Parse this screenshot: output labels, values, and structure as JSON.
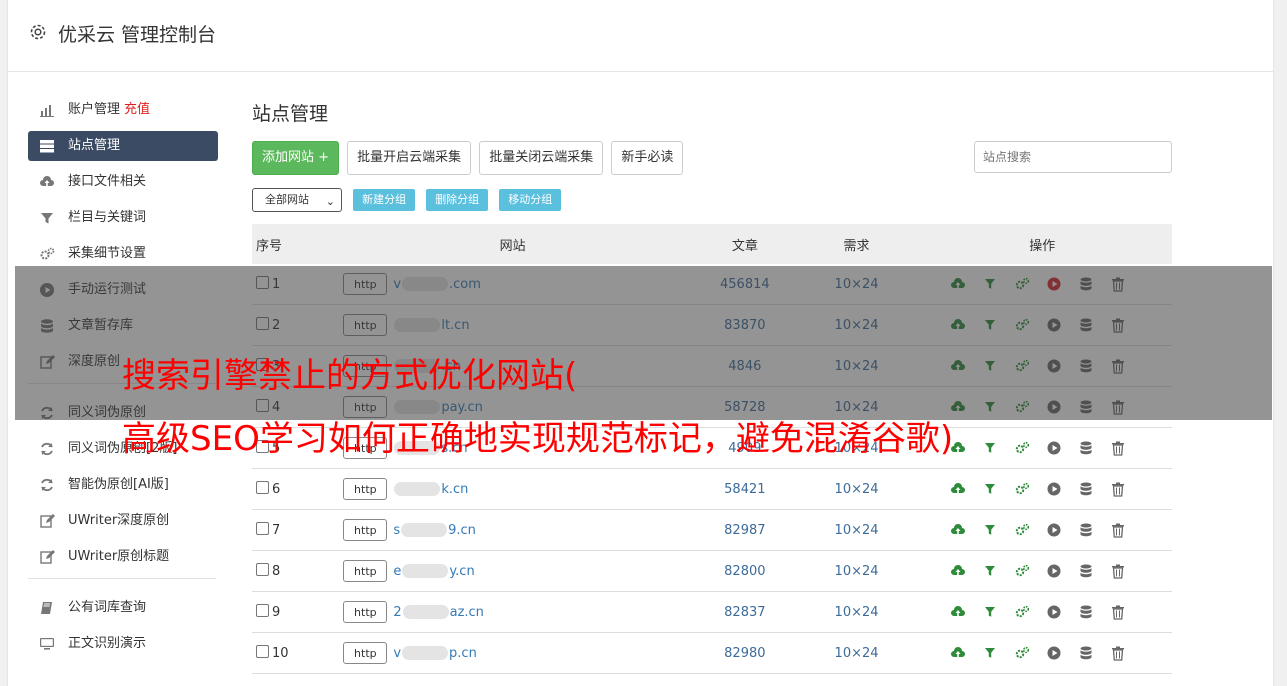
{
  "header": {
    "title": "优采云 管理控制台"
  },
  "sidebar": {
    "items": [
      {
        "label": "账户管理",
        "extra": "充值",
        "icon": "bar-chart-icon"
      },
      {
        "label": "站点管理",
        "icon": "server-icon",
        "active": true
      },
      {
        "label": "接口文件相关",
        "icon": "cloud-upload-icon"
      },
      {
        "label": "栏目与关键词",
        "icon": "filter-icon"
      },
      {
        "label": "采集细节设置",
        "icon": "gears-icon"
      },
      {
        "label": "手动运行测试",
        "icon": "play-circle-icon"
      },
      {
        "label": "文章暂存库",
        "icon": "database-icon"
      },
      {
        "label": "深度原创",
        "icon": "edit-icon"
      }
    ],
    "items2": [
      {
        "label": "同义词伪原创",
        "icon": "refresh-icon"
      },
      {
        "label": "同义词伪原创[2版]",
        "icon": "refresh-icon"
      },
      {
        "label": "智能伪原创[AI版]",
        "icon": "refresh-icon"
      },
      {
        "label": "UWriter深度原创",
        "icon": "edit-icon"
      },
      {
        "label": "UWriter原创标题",
        "icon": "edit-icon"
      }
    ],
    "items3": [
      {
        "label": "公有词库查询",
        "icon": "book-icon"
      },
      {
        "label": "正文识别演示",
        "icon": "monitor-icon"
      }
    ]
  },
  "main": {
    "title": "站点管理",
    "toolbar": {
      "add_label": "添加网站 +",
      "batch_on_label": "批量开启云端采集",
      "batch_off_label": "批量关闭云端采集",
      "guide_label": "新手必读",
      "search_placeholder": "站点搜索"
    },
    "group": {
      "select_value": "全部网站",
      "new_label": "新建分组",
      "delete_label": "删除分组",
      "move_label": "移动分组"
    },
    "table": {
      "headers": {
        "no": "序号",
        "site": "网站",
        "articles": "文章",
        "demand": "需求",
        "ops": "操作"
      },
      "http_label": "http",
      "rows": [
        {
          "no": "1",
          "pre": "v",
          "post": ".com",
          "articles": "456814",
          "demand": "10×24",
          "running": true
        },
        {
          "no": "2",
          "pre": "",
          "post": "lt.cn",
          "articles": "83870",
          "demand": "10×24"
        },
        {
          "no": "3",
          "pre": "",
          "post": ".cn",
          "articles": "4846",
          "demand": "10×24"
        },
        {
          "no": "4",
          "pre": "",
          "post": "pay.cn",
          "articles": "58728",
          "demand": "10×24"
        },
        {
          "no": "5",
          "pre": "",
          "post": "s.cn",
          "articles": "4909",
          "demand": "10×24"
        },
        {
          "no": "6",
          "pre": "",
          "post": "k.cn",
          "articles": "58421",
          "demand": "10×24"
        },
        {
          "no": "7",
          "pre": "s",
          "post": "9.cn",
          "articles": "82987",
          "demand": "10×24"
        },
        {
          "no": "8",
          "pre": "e",
          "post": "y.cn",
          "articles": "82800",
          "demand": "10×24"
        },
        {
          "no": "9",
          "pre": "2",
          "post": "az.cn",
          "articles": "82837",
          "demand": "10×24"
        },
        {
          "no": "10",
          "pre": "v",
          "post": "p.cn",
          "articles": "82980",
          "demand": "10×24"
        }
      ]
    }
  },
  "overlay": {
    "line1": "搜索引擎禁止的方式优化网站(",
    "line2": "高级SEO学习如何正确地实现规范标记，避免混淆谷歌)"
  },
  "colors": {
    "accent_dark": "#3b4b63",
    "green": "#5cb85c",
    "info": "#5bc0de",
    "headline": "#ff0000"
  }
}
